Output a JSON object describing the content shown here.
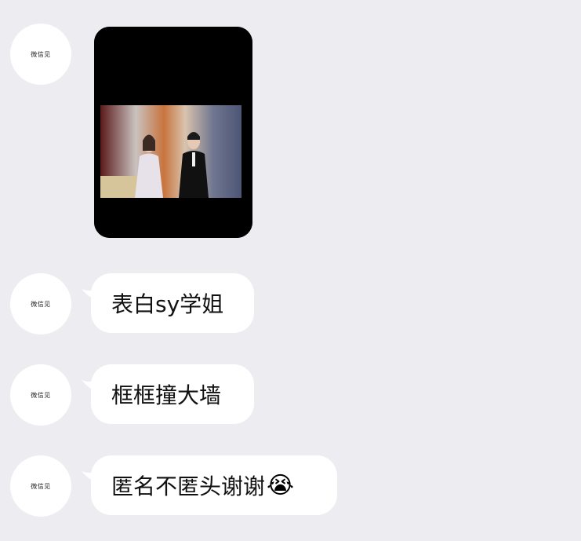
{
  "messages": [
    {
      "type": "image",
      "avatar_label": "微信见"
    },
    {
      "type": "text",
      "avatar_label": "微信见",
      "text": "表白sy学姐"
    },
    {
      "type": "text",
      "avatar_label": "微信见",
      "text": "框框撞大墙"
    },
    {
      "type": "text",
      "avatar_label": "微信见",
      "text": "匿名不匿头谢谢",
      "emoji": "😭"
    }
  ],
  "colors": {
    "background": "#ededf1",
    "bubble": "#ffffff",
    "text": "#111111"
  }
}
